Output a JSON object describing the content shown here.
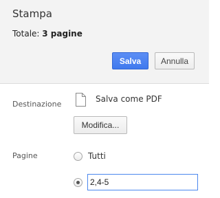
{
  "header": {
    "title": "Stampa",
    "total_label": "Totale: ",
    "total_value": "3 pagine",
    "save_label": "Salva",
    "cancel_label": "Annulla"
  },
  "destination": {
    "label": "Destinazione",
    "icon": "document-icon",
    "name": "Salva come PDF",
    "change_label": "Modifica..."
  },
  "pages": {
    "label": "Pagine",
    "options": [
      {
        "label": "Tutti",
        "selected": false
      },
      {
        "label": "",
        "selected": true
      }
    ],
    "custom_value": "2,4-5"
  },
  "colors": {
    "primary_button": "#4285f4",
    "header_background": "#f3f3f3",
    "input_focus_border": "#4a87ee"
  }
}
